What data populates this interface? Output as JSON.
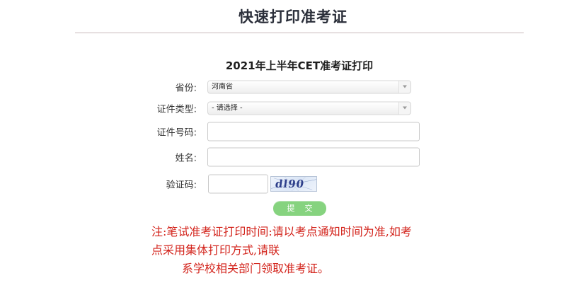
{
  "header": {
    "title": "快速打印准考证"
  },
  "form": {
    "title": "2021年上半年CET准考证打印",
    "province": {
      "label": "省份:",
      "selected": "河南省"
    },
    "id_type": {
      "label": "证件类型:",
      "selected": "- 请选择 -"
    },
    "id_number": {
      "label": "证件号码:",
      "value": ""
    },
    "name": {
      "label": "姓名:",
      "value": ""
    },
    "captcha": {
      "label": "验证码:",
      "value": "",
      "image_text": "dl90"
    },
    "submit_label": "提交"
  },
  "notice": {
    "line1": "注:笔试准考证打印时间:请以考点通知时间为准,如考",
    "line2": "点采用集体打印方式,请联",
    "line3": "系学校相关部门领取准考证。"
  },
  "colors": {
    "notice": "#d3241c",
    "submit": "#86d37f"
  }
}
